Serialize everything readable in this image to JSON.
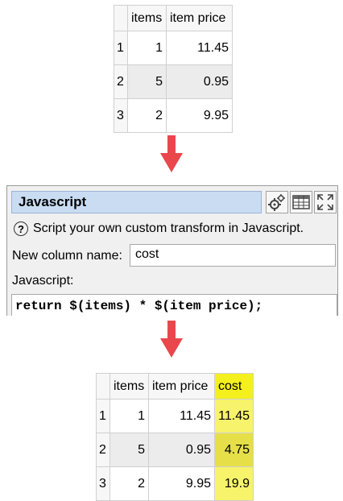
{
  "input_table": {
    "headers": [
      "",
      "items",
      "item price"
    ],
    "rows": [
      {
        "n": "1",
        "items": "1",
        "price": "11.45"
      },
      {
        "n": "2",
        "items": "5",
        "price": "0.95"
      },
      {
        "n": "3",
        "items": "2",
        "price": "9.95"
      }
    ]
  },
  "transform_panel": {
    "title": "Javascript",
    "description": "Script your own custom transform in Javascript.",
    "help_glyph": "?",
    "column_name_label": "New column name:",
    "column_name_value": "cost",
    "script_label": "Javascript:",
    "script": "return $(items) * $(item price);",
    "icons": [
      "gears-icon",
      "table-icon",
      "maximize-icon"
    ]
  },
  "output_table": {
    "headers": [
      "",
      "items",
      "item price",
      "cost"
    ],
    "rows": [
      {
        "n": "1",
        "items": "1",
        "price": "11.45",
        "cost": "11.45"
      },
      {
        "n": "2",
        "items": "5",
        "price": "0.95",
        "cost": "4.75"
      },
      {
        "n": "3",
        "items": "2",
        "price": "9.95",
        "cost": "19.9"
      }
    ]
  },
  "colors": {
    "arrow": "#e9474c",
    "highlight_column": "#f7f36a",
    "title_bar": "#c9dcf2"
  }
}
